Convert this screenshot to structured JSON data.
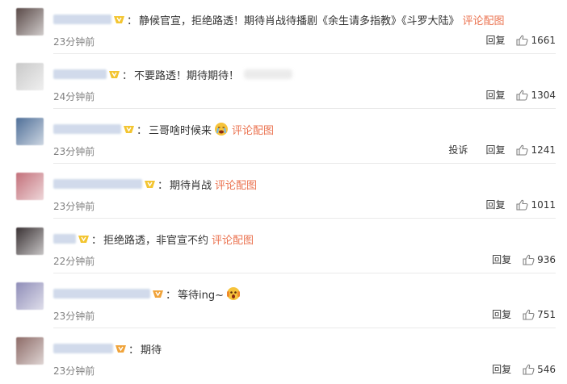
{
  "comments": [
    {
      "user_hint": "",
      "text": "静候官宣，拒绝路透！期待肖战待播剧《余生请多指教》《斗罗大陆》",
      "link": "评论配图",
      "time": "23分钟前",
      "report": "",
      "reply": "回复",
      "likes": "1661",
      "badge": "gold",
      "avatar": "#5a4a48",
      "name_w": 72,
      "emoji": ""
    },
    {
      "user_hint": "",
      "text": "不要路透！期待期待！",
      "link": "",
      "time": "24分钟前",
      "report": "",
      "reply": "回复",
      "likes": "1304",
      "badge": "gold",
      "avatar": "#c9c9c9",
      "name_w": 66,
      "emoji": ""
    },
    {
      "user_hint": "",
      "text": "三哥啥时候来",
      "link": "评论配图",
      "time": "23分钟前",
      "report": "投诉",
      "reply": "回复",
      "likes": "1241",
      "badge": "gold",
      "avatar": "#4f6f98",
      "name_w": 84,
      "emoji": "cry"
    },
    {
      "user_hint": "",
      "text": "期待肖战",
      "link": "评论配图",
      "time": "23分钟前",
      "report": "",
      "reply": "回复",
      "likes": "1011",
      "badge": "gold",
      "avatar": "#c3707a",
      "name_w": 110,
      "emoji": ""
    },
    {
      "user_hint": "",
      "text": "拒绝路透，非官宣不约",
      "link": "评论配图",
      "time": "22分钟前",
      "report": "",
      "reply": "回复",
      "likes": "936",
      "badge": "gold",
      "avatar": "#3a3234",
      "name_w": 28,
      "emoji": ""
    },
    {
      "user_hint": "",
      "text": "等待ing~",
      "link": "",
      "time": "23分钟前",
      "report": "",
      "reply": "回复",
      "likes": "751",
      "badge": "orange",
      "avatar": "#8f8db8",
      "name_w": 120,
      "emoji": "shock"
    },
    {
      "user_hint": "",
      "text": "期待",
      "link": "",
      "time": "23分钟前",
      "report": "",
      "reply": "回复",
      "likes": "546",
      "badge": "orange",
      "avatar": "#8d6b67",
      "name_w": 74,
      "emoji": ""
    }
  ],
  "colors": {
    "link": "#eb7350",
    "time": "#808080",
    "divider": "#eaeaea"
  }
}
